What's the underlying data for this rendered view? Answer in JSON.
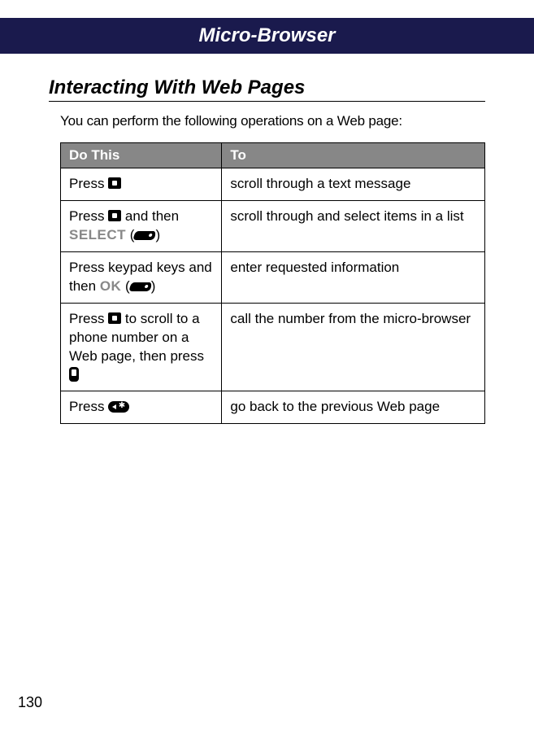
{
  "header": {
    "title": "Micro-Browser"
  },
  "section": {
    "heading": "Interacting With Web Pages",
    "intro": "You can perform the following operations on a Web page:"
  },
  "table": {
    "headers": {
      "col1": "Do This",
      "col2": "To"
    },
    "rows": [
      {
        "do_pre": "Press ",
        "icon1": "nav",
        "do_post": "",
        "to": "scroll through a text message"
      },
      {
        "do_pre": "Press ",
        "icon1": "nav",
        "do_mid": " and then ",
        "soft_label": "SELECT",
        "do_lp": " (",
        "icon2": "softkey",
        "do_rp": ")",
        "to": "scroll through and select items in a list"
      },
      {
        "do_pre": "Press keypad keys and then ",
        "soft_label": "OK",
        "do_lp": " (",
        "icon2": "softkey",
        "do_rp": ")",
        "to": "enter requested information"
      },
      {
        "do_pre": "Press ",
        "icon1": "nav",
        "do_mid": " to scroll to a phone number on a Web page, then press ",
        "icon2": "call",
        "to": "call the number from the micro-browser"
      },
      {
        "do_pre": "Press ",
        "icon1": "back",
        "to": "go back to the previous Web page"
      }
    ]
  },
  "page_number": "130"
}
